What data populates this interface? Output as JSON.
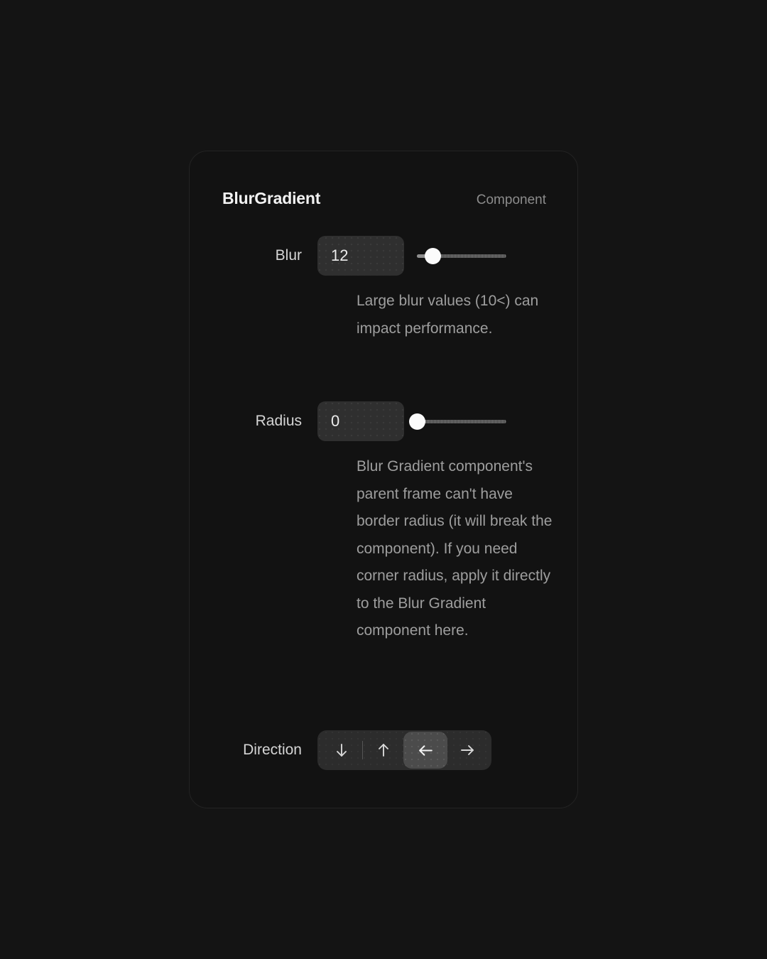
{
  "panel": {
    "title": "BlurGradient",
    "kind": "Component"
  },
  "properties": {
    "blur": {
      "label": "Blur",
      "value": "12",
      "slider": {
        "min": 0,
        "max": 100,
        "value": 18
      },
      "help": "Large blur values (10<) can impact performance."
    },
    "radius": {
      "label": "Radius",
      "value": "0",
      "slider": {
        "min": 0,
        "max": 100,
        "value": 0
      },
      "help": "Blur Gradient component's parent frame can't have border radius (it will break the component). If you need corner radius, apply it directly to the Blur Gradient component here."
    },
    "direction": {
      "label": "Direction",
      "selected": "left",
      "options": [
        {
          "id": "down",
          "icon": "arrow-down-icon",
          "label": "Down"
        },
        {
          "id": "up",
          "icon": "arrow-up-icon",
          "label": "Up"
        },
        {
          "id": "left",
          "icon": "arrow-left-icon",
          "label": "Left"
        },
        {
          "id": "right",
          "icon": "arrow-right-icon",
          "label": "Right"
        }
      ]
    }
  },
  "colors": {
    "background": "#141414",
    "panel": "#121212",
    "field": "#2f2f2f",
    "selected": "#4b4b4b",
    "text_primary": "#f2f2f2",
    "text_muted": "#8c8c8c",
    "text_help": "#9e9e9e",
    "thumb": "#fbfbfb"
  }
}
